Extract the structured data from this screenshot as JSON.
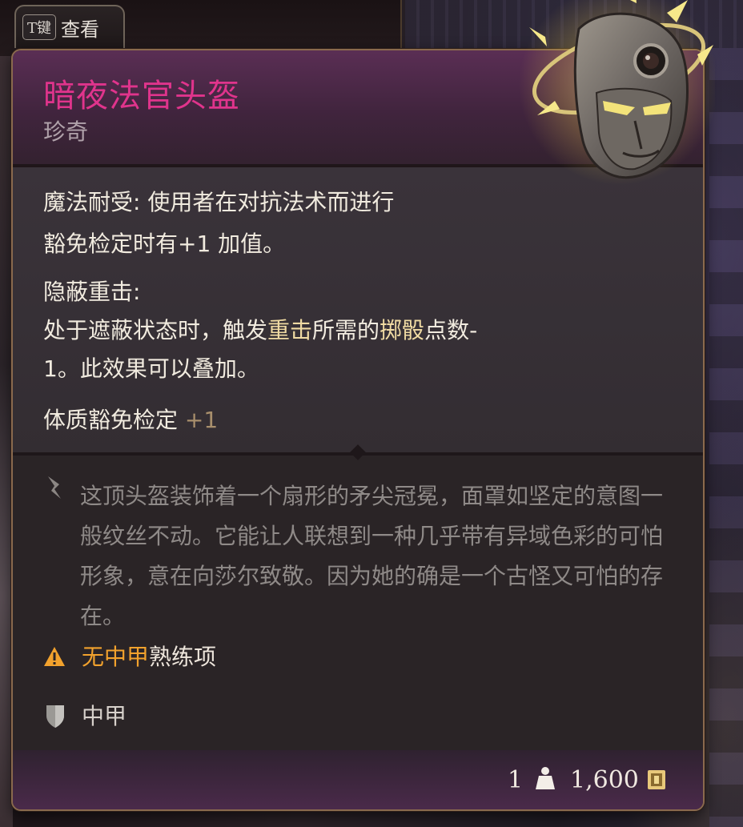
{
  "key_hint": {
    "key": "T键",
    "label": "查看"
  },
  "item": {
    "name": "暗夜法官头盔",
    "rarity": "珍奇",
    "name_color": "#e0348c"
  },
  "properties": {
    "magic_resistance": {
      "title": "魔法耐受:",
      "line1_rest": " 使用者在对抗法术而进行",
      "line2": "豁免检定时有+1 加值。"
    },
    "hidden_strike": {
      "title": "隐蔽重击:",
      "line1_pre": "处于遮蔽状态时，触发",
      "line1_hl1": "重击",
      "line1_mid": "所需的",
      "line1_hl2": "掷骰",
      "line1_post": "点数-",
      "line2": "1。此效果可以叠加。"
    },
    "save_bonus": {
      "label": "体质豁免检定",
      "value": "+1"
    }
  },
  "description": "这顶头盔装饰着一个扇形的矛尖冠冕，面罩如坚定的意图一般纹丝不动。它能让人联想到一种几乎带有异域色彩的可怕形象，意在向莎尔致敬。因为她的确是一个古怪又可怕的存在。",
  "proficiency_warning": {
    "highlight": "无中甲",
    "rest": "熟练项",
    "icon": "warning-icon",
    "color": "#f2a22d"
  },
  "armor_type": {
    "label": "中甲",
    "icon": "shield-icon"
  },
  "footer": {
    "weight": "1",
    "price": "1,600",
    "weight_icon": "weight-icon",
    "price_icon": "gold-coin-icon"
  }
}
